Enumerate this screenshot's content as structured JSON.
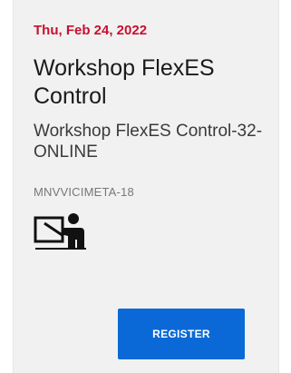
{
  "event": {
    "date": "Thu, Feb 24, 2022",
    "title": "Workshop FlexES Control",
    "subtitle": "Workshop FlexES Control-32-ONLINE",
    "code": "MNVVICIMETA-18",
    "icon": "presentation-teacher-icon"
  },
  "actions": {
    "register_label": "REGISTER"
  },
  "colors": {
    "date_accent": "#c8102e",
    "button_bg": "#0a69d6",
    "card_bg": "#f1f1f1"
  }
}
